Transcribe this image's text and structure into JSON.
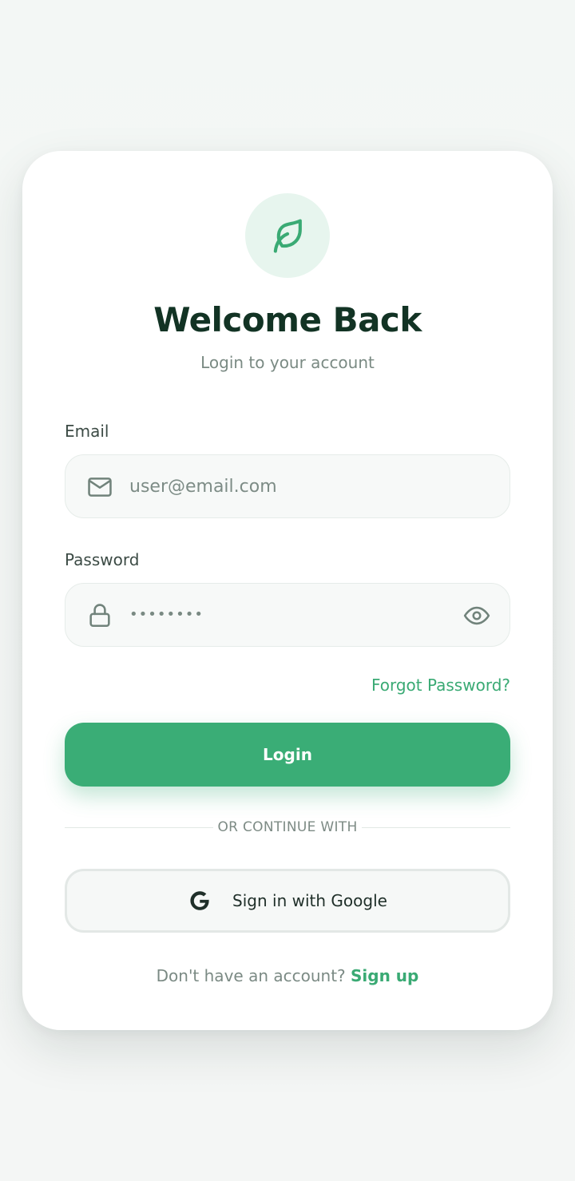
{
  "header": {
    "title": "Welcome Back",
    "subtitle": "Login to your account"
  },
  "email": {
    "label": "Email",
    "placeholder": "user@email.com",
    "value": ""
  },
  "password": {
    "label": "Password",
    "masked_value": "••••••••"
  },
  "actions": {
    "forgot_label": "Forgot Password?",
    "login_label": "Login",
    "divider_label": "OR CONTINUE WITH",
    "google_label": "Sign in with Google"
  },
  "footer": {
    "prompt": "Don't have an account?",
    "signup_label": "Sign up"
  },
  "icons": {
    "logo": "leaf-icon",
    "email": "mail-icon",
    "password": "lock-icon",
    "toggle": "eye-icon",
    "google": "google-icon"
  },
  "colors": {
    "accent": "#3aad76",
    "title": "#123324",
    "logo_bg": "#e7f5ee"
  }
}
